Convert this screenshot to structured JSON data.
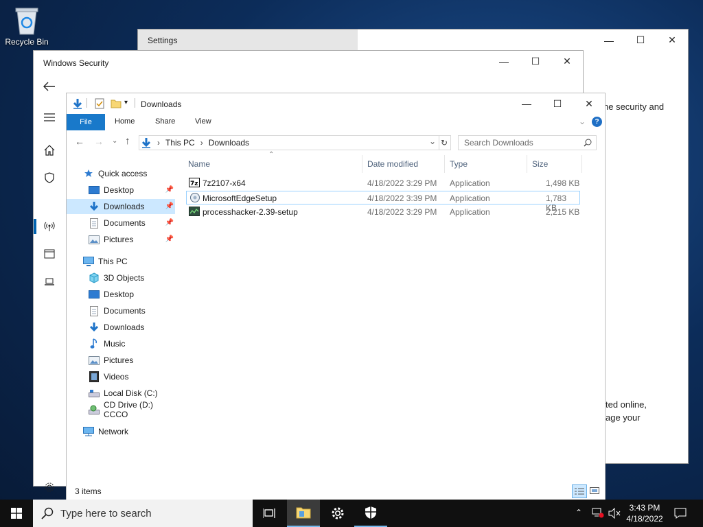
{
  "desktop": {
    "recycle_bin_label": "Recycle Bin"
  },
  "settings_window": {
    "title": "Settings",
    "text_line1": "ne security and",
    "text_line2": "ted online,",
    "text_line3": "age your"
  },
  "security_window": {
    "title": "Windows Security"
  },
  "explorer": {
    "title": "Downloads",
    "tabs": {
      "file": "File",
      "home": "Home",
      "share": "Share",
      "view": "View"
    },
    "address": {
      "root": "This PC",
      "current": "Downloads"
    },
    "search_placeholder": "Search Downloads",
    "tree": {
      "quick_access": "Quick access",
      "qa_desktop": "Desktop",
      "qa_downloads": "Downloads",
      "qa_documents": "Documents",
      "qa_pictures": "Pictures",
      "this_pc": "This PC",
      "objects3d": "3D Objects",
      "desktop": "Desktop",
      "documents": "Documents",
      "downloads": "Downloads",
      "music": "Music",
      "pictures": "Pictures",
      "videos": "Videos",
      "local_disk": "Local Disk (C:)",
      "cd_drive": "CD Drive (D:) CCCO",
      "network": "Network"
    },
    "columns": {
      "name": "Name",
      "date": "Date modified",
      "type": "Type",
      "size": "Size"
    },
    "files": [
      {
        "name": "7z2107-x64",
        "date": "4/18/2022 3:29 PM",
        "type": "Application",
        "size": "1,498 KB"
      },
      {
        "name": "MicrosoftEdgeSetup",
        "date": "4/18/2022 3:39 PM",
        "type": "Application",
        "size": "1,783 KB"
      },
      {
        "name": "processhacker-2.39-setup",
        "date": "4/18/2022 3:29 PM",
        "type": "Application",
        "size": "2,215 KB"
      }
    ],
    "status": "3 items"
  },
  "taskbar": {
    "search_placeholder": "Type here to search",
    "time": "3:43 PM",
    "date": "4/18/2022"
  }
}
